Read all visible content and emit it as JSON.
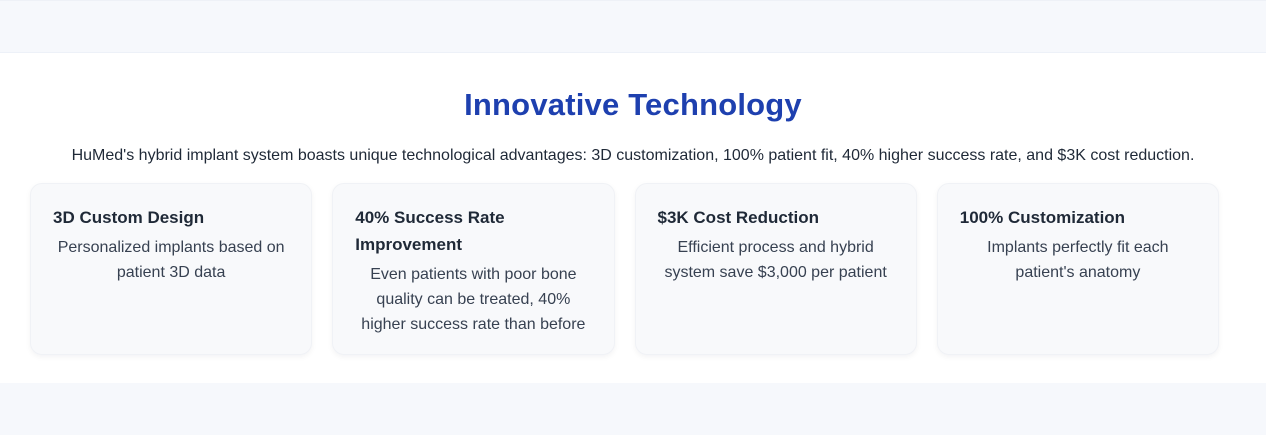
{
  "section": {
    "title": "Innovative Technology",
    "subtitle": "HuMed's hybrid implant system boasts unique technological advantages: 3D customization, 100% patient fit, 40% higher success rate, and $3K cost reduction."
  },
  "cards": [
    {
      "title": "3D Custom Design",
      "description": "Personalized implants based on patient 3D data"
    },
    {
      "title": "40% Success Rate Improvement",
      "description": "Even patients with poor bone quality can be treated, 40% higher success rate than before"
    },
    {
      "title": "$3K Cost Reduction",
      "description": "Efficient process and hybrid system save $3,000 per patient"
    },
    {
      "title": "100% Customization",
      "description": "Implants perfectly fit each patient's anatomy"
    }
  ],
  "colors": {
    "title": "#1e40af",
    "card_background": "#f8f9fb",
    "page_background": "#f6f8fc"
  }
}
